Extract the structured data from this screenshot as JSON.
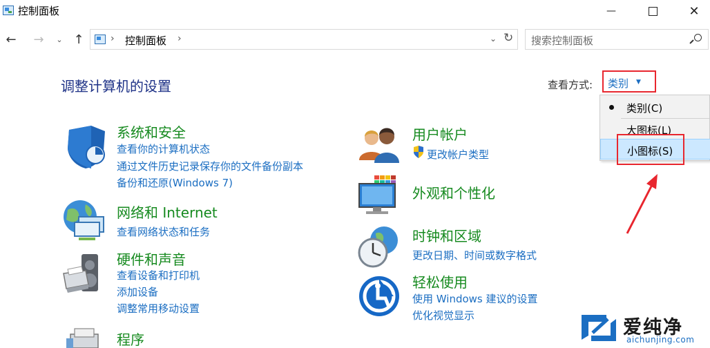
{
  "window": {
    "title": "控制面板",
    "minimize_glyph": "—",
    "close_glyph": "✕"
  },
  "navigation": {
    "back_glyph": "←",
    "forward_glyph": "→",
    "recent_glyph": "⌄",
    "up_glyph": "↑",
    "breadcrumb": "控制面板",
    "breadcrumb_separator": "›",
    "dropdown_glyph": "⌄",
    "refresh_glyph": "↻",
    "search_placeholder": "搜索控制面板"
  },
  "header": {
    "heading": "调整计算机的设置",
    "view_label": "查看方式:",
    "view_value": "类别",
    "view_caret": "▼"
  },
  "view_menu": {
    "items": [
      {
        "label": "类别(C)",
        "selected": true
      },
      {
        "label": "大图标(L)",
        "selected": false
      },
      {
        "label": "小图标(S)",
        "selected": false,
        "hovered": true
      }
    ]
  },
  "categories": {
    "security": {
      "icon": "shield-icon",
      "title": "系统和安全",
      "links": [
        "查看你的计算机状态",
        "通过文件历史记录保存你的文件备份副本",
        "备份和还原(Windows 7)"
      ]
    },
    "network": {
      "icon": "network-globe-icon",
      "title": "网络和 Internet",
      "links": [
        "查看网络状态和任务"
      ]
    },
    "hardware": {
      "icon": "printer-speaker-icon",
      "title": "硬件和声音",
      "links": [
        "查看设备和打印机",
        "添加设备",
        "调整常用移动设置"
      ]
    },
    "programs": {
      "icon": "programs-icon",
      "title": "程序",
      "links": []
    },
    "user": {
      "icon": "users-icon",
      "title": "用户帐户",
      "links": [
        "更改帐户类型"
      ]
    },
    "appearance": {
      "icon": "monitor-palette-icon",
      "title": "外观和个性化",
      "links": []
    },
    "clock": {
      "icon": "clock-globe-icon",
      "title": "时钟和区域",
      "links": [
        "更改日期、时间或数字格式"
      ]
    },
    "ease": {
      "icon": "ease-of-access-icon",
      "title": "轻松使用",
      "links": [
        "使用 Windows 建议的设置",
        "优化视觉显示"
      ]
    }
  },
  "watermark": {
    "title": "爱纯净",
    "url": "aichunjing.com"
  },
  "colors": {
    "category_title": "#168a1f",
    "link": "#1b6ec2",
    "heading": "#1e3287",
    "annotation_red": "#e8262e",
    "menu_hover": "#cce8ff"
  }
}
